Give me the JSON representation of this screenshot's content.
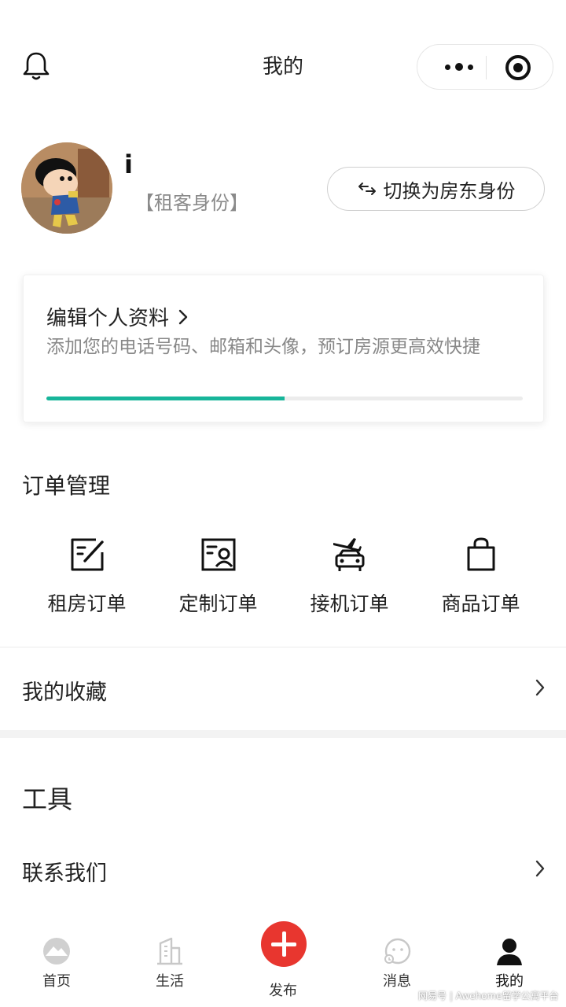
{
  "header": {
    "title": "我的"
  },
  "profile": {
    "username": "i",
    "role": "【租客身份】",
    "switch_label": "切换为房东身份"
  },
  "profile_card": {
    "title": "编辑个人资料",
    "description": "添加您的电话号码、邮箱和头像，预订房源更高效快捷",
    "progress_fraction": 0.5,
    "progress_color": "#17b59a"
  },
  "orders": {
    "title": "订单管理",
    "items": [
      {
        "label": "租房订单",
        "icon": "edit-doc-icon"
      },
      {
        "label": "定制订单",
        "icon": "profile-card-icon"
      },
      {
        "label": "接机订单",
        "icon": "airport-taxi-icon"
      },
      {
        "label": "商品订单",
        "icon": "shopping-bag-icon"
      }
    ]
  },
  "favorites": {
    "label": "我的收藏"
  },
  "tools": {
    "title": "工具",
    "contact_label": "联系我们"
  },
  "tabbar": {
    "items": [
      {
        "label": "首页",
        "icon": "home-icon"
      },
      {
        "label": "生活",
        "icon": "building-icon"
      },
      {
        "label": "发布",
        "icon": "plus-icon"
      },
      {
        "label": "消息",
        "icon": "message-icon"
      },
      {
        "label": "我的",
        "icon": "user-icon"
      }
    ],
    "active_color": "#111111",
    "inactive_color": "#cccccc",
    "publish_color": "#e8362f"
  },
  "watermark": "网易号 | Awehome留学公寓平台"
}
